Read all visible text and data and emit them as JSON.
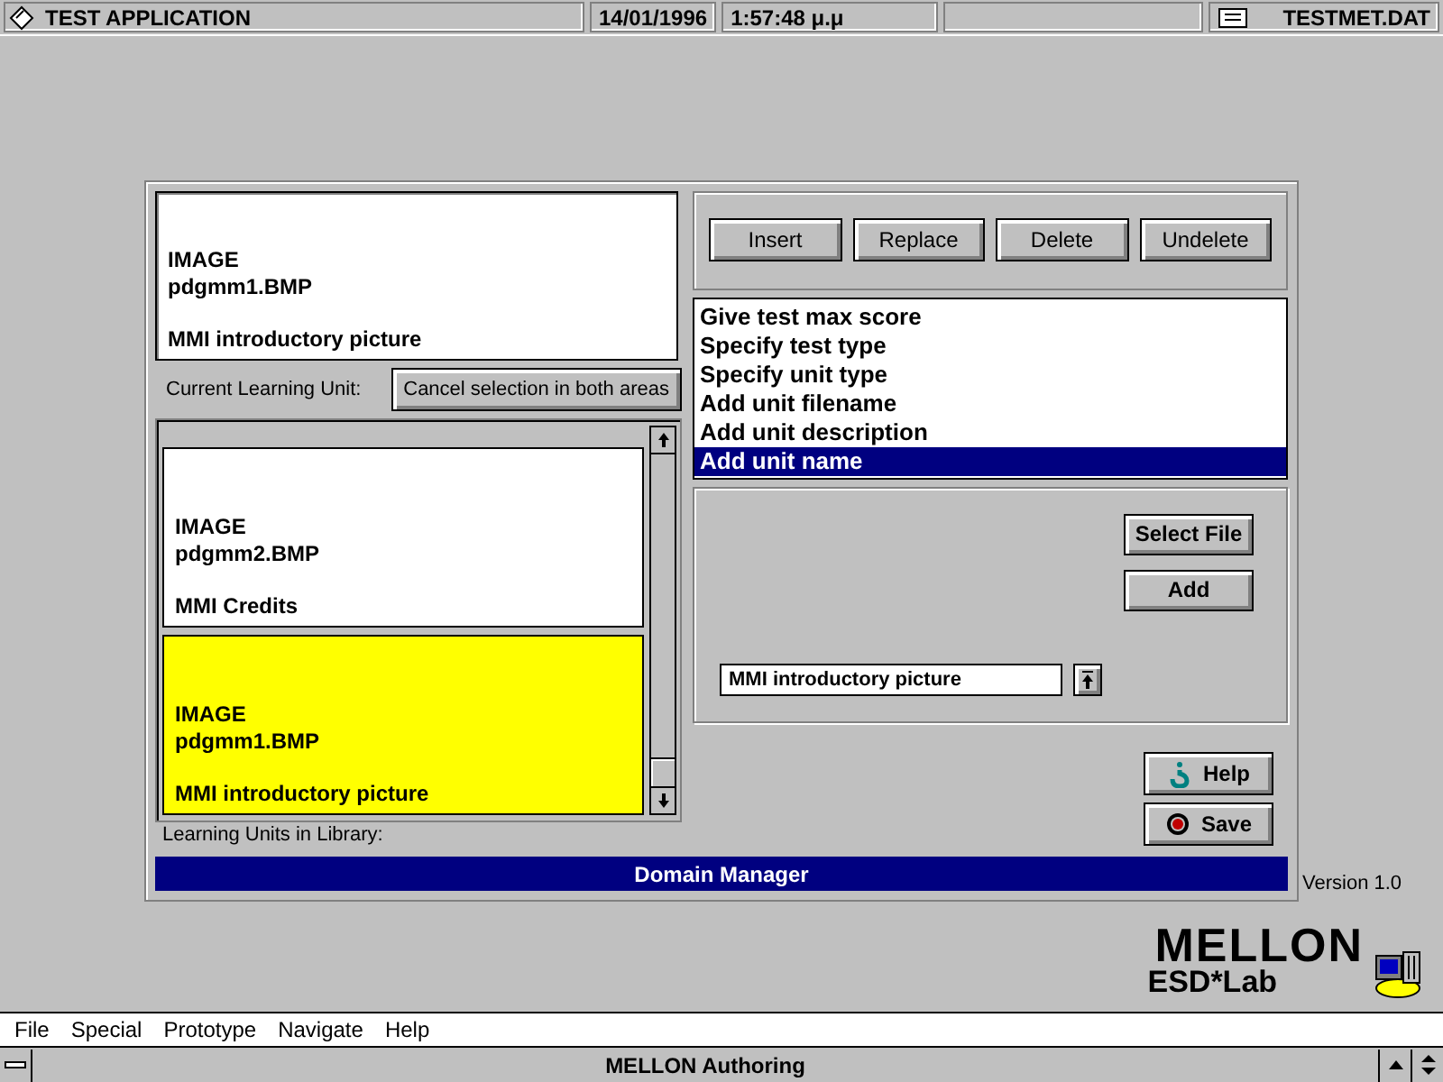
{
  "status_bar": {
    "application": "TEST APPLICATION",
    "date": "14/01/1996",
    "time": "1:57:48 μ.μ",
    "file": "TESTMET.DAT"
  },
  "dialog": {
    "current_unit": [
      "IMAGE",
      "pdgmm1.BMP",
      "MMI introductory picture"
    ],
    "current_label": "Current Learning Unit:",
    "cancel_button": "Cancel selection in both areas",
    "library": [
      {
        "lines": [
          "IMAGE",
          "pdgmm2.BMP",
          "MMI Credits"
        ],
        "selected": false
      },
      {
        "lines": [
          "IMAGE",
          "pdgmm1.BMP",
          "MMI introductory picture"
        ],
        "selected": true
      }
    ],
    "library_label": "Learning Units in Library:",
    "edit_buttons": [
      "Insert",
      "Replace",
      "Delete",
      "Undelete"
    ],
    "steps": [
      {
        "label": "Give test max score",
        "selected": false
      },
      {
        "label": "Specify test type",
        "selected": false
      },
      {
        "label": "Specify unit type",
        "selected": false
      },
      {
        "label": "Add unit filename",
        "selected": false
      },
      {
        "label": "Add unit description",
        "selected": false
      },
      {
        "label": "Add unit name",
        "selected": true
      }
    ],
    "file_buttons": [
      "Select File",
      "Add"
    ],
    "unit_field": {
      "value": "MMI introductory picture"
    },
    "side_buttons": [
      {
        "kind": "help",
        "label": "Help"
      },
      {
        "kind": "save",
        "label": "Save"
      }
    ],
    "title": "Domain Manager"
  },
  "logo": {
    "version": "Version 1.0",
    "product": "MELLON",
    "lab": "ESD*Lab"
  },
  "menu": [
    "File",
    "Special",
    "Prototype",
    "Navigate",
    "Help"
  ],
  "window": {
    "title": "MELLON Authoring"
  }
}
